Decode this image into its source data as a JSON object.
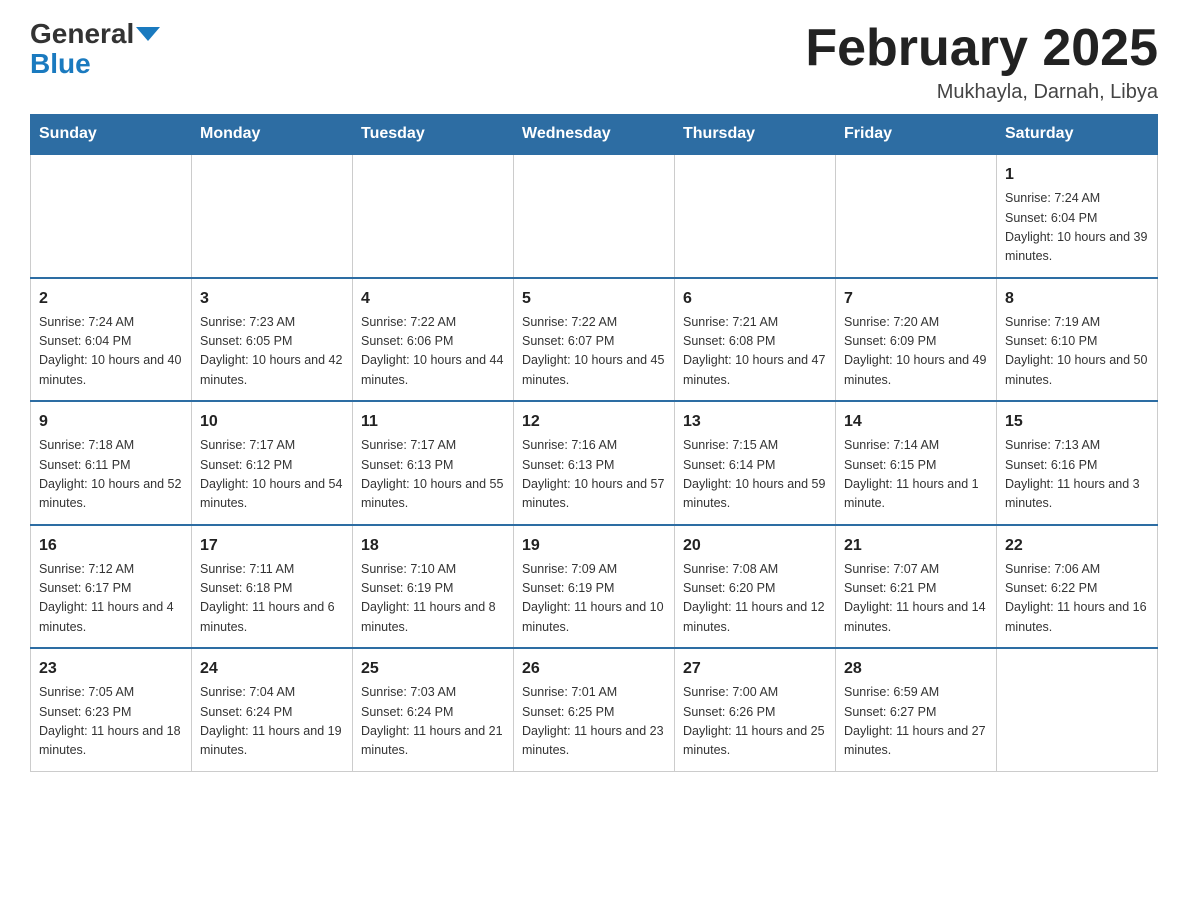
{
  "header": {
    "logo_main": "General",
    "logo_sub": "Blue",
    "title": "February 2025",
    "location": "Mukhayla, Darnah, Libya"
  },
  "days_of_week": [
    "Sunday",
    "Monday",
    "Tuesday",
    "Wednesday",
    "Thursday",
    "Friday",
    "Saturday"
  ],
  "weeks": [
    [
      {
        "day": "",
        "sunrise": "",
        "sunset": "",
        "daylight": ""
      },
      {
        "day": "",
        "sunrise": "",
        "sunset": "",
        "daylight": ""
      },
      {
        "day": "",
        "sunrise": "",
        "sunset": "",
        "daylight": ""
      },
      {
        "day": "",
        "sunrise": "",
        "sunset": "",
        "daylight": ""
      },
      {
        "day": "",
        "sunrise": "",
        "sunset": "",
        "daylight": ""
      },
      {
        "day": "",
        "sunrise": "",
        "sunset": "",
        "daylight": ""
      },
      {
        "day": "1",
        "sunrise": "Sunrise: 7:24 AM",
        "sunset": "Sunset: 6:04 PM",
        "daylight": "Daylight: 10 hours and 39 minutes."
      }
    ],
    [
      {
        "day": "2",
        "sunrise": "Sunrise: 7:24 AM",
        "sunset": "Sunset: 6:04 PM",
        "daylight": "Daylight: 10 hours and 40 minutes."
      },
      {
        "day": "3",
        "sunrise": "Sunrise: 7:23 AM",
        "sunset": "Sunset: 6:05 PM",
        "daylight": "Daylight: 10 hours and 42 minutes."
      },
      {
        "day": "4",
        "sunrise": "Sunrise: 7:22 AM",
        "sunset": "Sunset: 6:06 PM",
        "daylight": "Daylight: 10 hours and 44 minutes."
      },
      {
        "day": "5",
        "sunrise": "Sunrise: 7:22 AM",
        "sunset": "Sunset: 6:07 PM",
        "daylight": "Daylight: 10 hours and 45 minutes."
      },
      {
        "day": "6",
        "sunrise": "Sunrise: 7:21 AM",
        "sunset": "Sunset: 6:08 PM",
        "daylight": "Daylight: 10 hours and 47 minutes."
      },
      {
        "day": "7",
        "sunrise": "Sunrise: 7:20 AM",
        "sunset": "Sunset: 6:09 PM",
        "daylight": "Daylight: 10 hours and 49 minutes."
      },
      {
        "day": "8",
        "sunrise": "Sunrise: 7:19 AM",
        "sunset": "Sunset: 6:10 PM",
        "daylight": "Daylight: 10 hours and 50 minutes."
      }
    ],
    [
      {
        "day": "9",
        "sunrise": "Sunrise: 7:18 AM",
        "sunset": "Sunset: 6:11 PM",
        "daylight": "Daylight: 10 hours and 52 minutes."
      },
      {
        "day": "10",
        "sunrise": "Sunrise: 7:17 AM",
        "sunset": "Sunset: 6:12 PM",
        "daylight": "Daylight: 10 hours and 54 minutes."
      },
      {
        "day": "11",
        "sunrise": "Sunrise: 7:17 AM",
        "sunset": "Sunset: 6:13 PM",
        "daylight": "Daylight: 10 hours and 55 minutes."
      },
      {
        "day": "12",
        "sunrise": "Sunrise: 7:16 AM",
        "sunset": "Sunset: 6:13 PM",
        "daylight": "Daylight: 10 hours and 57 minutes."
      },
      {
        "day": "13",
        "sunrise": "Sunrise: 7:15 AM",
        "sunset": "Sunset: 6:14 PM",
        "daylight": "Daylight: 10 hours and 59 minutes."
      },
      {
        "day": "14",
        "sunrise": "Sunrise: 7:14 AM",
        "sunset": "Sunset: 6:15 PM",
        "daylight": "Daylight: 11 hours and 1 minute."
      },
      {
        "day": "15",
        "sunrise": "Sunrise: 7:13 AM",
        "sunset": "Sunset: 6:16 PM",
        "daylight": "Daylight: 11 hours and 3 minutes."
      }
    ],
    [
      {
        "day": "16",
        "sunrise": "Sunrise: 7:12 AM",
        "sunset": "Sunset: 6:17 PM",
        "daylight": "Daylight: 11 hours and 4 minutes."
      },
      {
        "day": "17",
        "sunrise": "Sunrise: 7:11 AM",
        "sunset": "Sunset: 6:18 PM",
        "daylight": "Daylight: 11 hours and 6 minutes."
      },
      {
        "day": "18",
        "sunrise": "Sunrise: 7:10 AM",
        "sunset": "Sunset: 6:19 PM",
        "daylight": "Daylight: 11 hours and 8 minutes."
      },
      {
        "day": "19",
        "sunrise": "Sunrise: 7:09 AM",
        "sunset": "Sunset: 6:19 PM",
        "daylight": "Daylight: 11 hours and 10 minutes."
      },
      {
        "day": "20",
        "sunrise": "Sunrise: 7:08 AM",
        "sunset": "Sunset: 6:20 PM",
        "daylight": "Daylight: 11 hours and 12 minutes."
      },
      {
        "day": "21",
        "sunrise": "Sunrise: 7:07 AM",
        "sunset": "Sunset: 6:21 PM",
        "daylight": "Daylight: 11 hours and 14 minutes."
      },
      {
        "day": "22",
        "sunrise": "Sunrise: 7:06 AM",
        "sunset": "Sunset: 6:22 PM",
        "daylight": "Daylight: 11 hours and 16 minutes."
      }
    ],
    [
      {
        "day": "23",
        "sunrise": "Sunrise: 7:05 AM",
        "sunset": "Sunset: 6:23 PM",
        "daylight": "Daylight: 11 hours and 18 minutes."
      },
      {
        "day": "24",
        "sunrise": "Sunrise: 7:04 AM",
        "sunset": "Sunset: 6:24 PM",
        "daylight": "Daylight: 11 hours and 19 minutes."
      },
      {
        "day": "25",
        "sunrise": "Sunrise: 7:03 AM",
        "sunset": "Sunset: 6:24 PM",
        "daylight": "Daylight: 11 hours and 21 minutes."
      },
      {
        "day": "26",
        "sunrise": "Sunrise: 7:01 AM",
        "sunset": "Sunset: 6:25 PM",
        "daylight": "Daylight: 11 hours and 23 minutes."
      },
      {
        "day": "27",
        "sunrise": "Sunrise: 7:00 AM",
        "sunset": "Sunset: 6:26 PM",
        "daylight": "Daylight: 11 hours and 25 minutes."
      },
      {
        "day": "28",
        "sunrise": "Sunrise: 6:59 AM",
        "sunset": "Sunset: 6:27 PM",
        "daylight": "Daylight: 11 hours and 27 minutes."
      },
      {
        "day": "",
        "sunrise": "",
        "sunset": "",
        "daylight": ""
      }
    ]
  ]
}
